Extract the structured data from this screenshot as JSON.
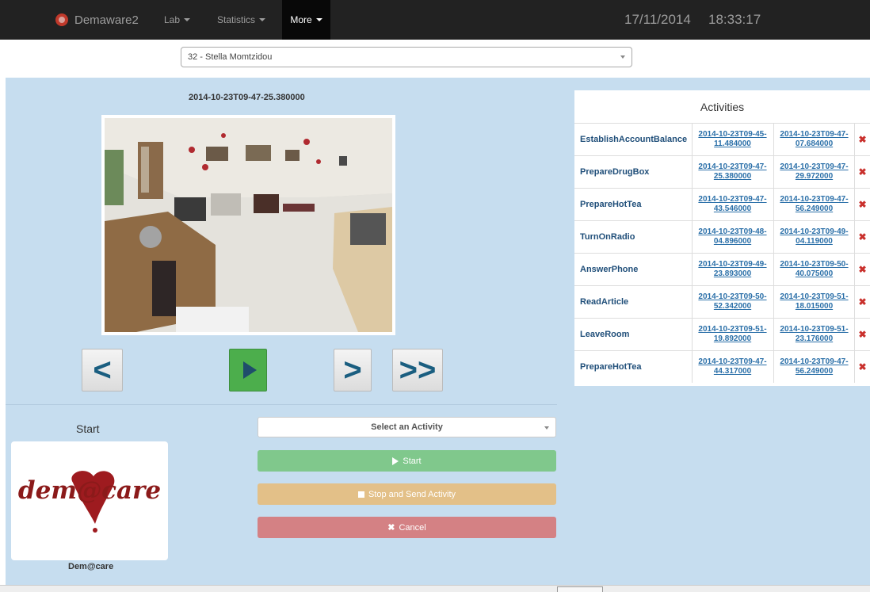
{
  "navbar": {
    "brand": "Demaware2",
    "menu": [
      {
        "label": "Lab"
      },
      {
        "label": "Statistics"
      },
      {
        "label": "More"
      }
    ],
    "date": "17/11/2014",
    "time": "18:33:17"
  },
  "patient": {
    "selected": "32 - Stella Momtzidou"
  },
  "video": {
    "timestamp": "2014-10-23T09-47-25.380000"
  },
  "controls": {
    "prev": "<",
    "next": ">",
    "fast_forward": ">>"
  },
  "recording": {
    "start_label": "Start",
    "logo_caption": "Dem@care",
    "logo_text": "dem@care",
    "activity_placeholder": "Select an Activity",
    "start_button": "Start",
    "stop_button": "Stop and Send Activity",
    "cancel_button": "Cancel"
  },
  "activities": {
    "title": "Activities",
    "rows": [
      {
        "name": "EstablishAccountBalance",
        "start": "2014-10-23T09-45-11.484000",
        "end": "2014-10-23T09-47-07.684000"
      },
      {
        "name": "PrepareDrugBox",
        "start": "2014-10-23T09-47-25.380000",
        "end": "2014-10-23T09-47-29.972000"
      },
      {
        "name": "PrepareHotTea",
        "start": "2014-10-23T09-47-43.546000",
        "end": "2014-10-23T09-47-56.249000"
      },
      {
        "name": "TurnOnRadio",
        "start": "2014-10-23T09-48-04.896000",
        "end": "2014-10-23T09-49-04.119000"
      },
      {
        "name": "AnswerPhone",
        "start": "2014-10-23T09-49-23.893000",
        "end": "2014-10-23T09-50-40.075000"
      },
      {
        "name": "ReadArticle",
        "start": "2014-10-23T09-50-52.342000",
        "end": "2014-10-23T09-51-18.015000"
      },
      {
        "name": "LeaveRoom",
        "start": "2014-10-23T09-51-19.892000",
        "end": "2014-10-23T09-51-23.176000"
      },
      {
        "name": "PrepareHotTea",
        "start": "2014-10-23T09-47-44.317000",
        "end": "2014-10-23T09-47-56.249000"
      }
    ]
  },
  "colors": {
    "navbar": "#222222",
    "panel_bg": "#c6ddef",
    "start": "#80c88c",
    "stop": "#e3c088",
    "cancel": "#d48184",
    "play": "#4cae4c"
  }
}
